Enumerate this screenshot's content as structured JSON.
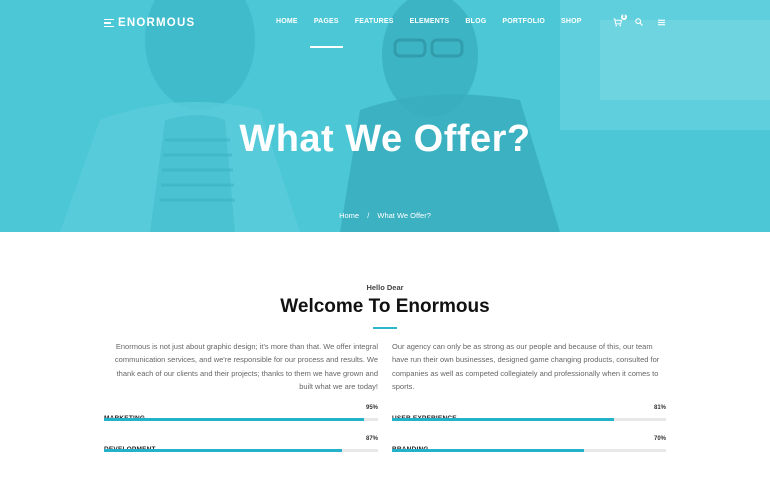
{
  "brand": {
    "name": "ENORMOUS",
    "accent_color": "#23b2c7"
  },
  "nav": {
    "items": [
      {
        "label": "HOME"
      },
      {
        "label": "PAGES",
        "active": true
      },
      {
        "label": "FEATURES"
      },
      {
        "label": "ELEMENTS"
      },
      {
        "label": "BLOG"
      },
      {
        "label": "PORTFOLIO"
      },
      {
        "label": "SHOP"
      }
    ],
    "cart_count": "0",
    "icons": [
      "cart-icon",
      "search-icon",
      "menu-icon"
    ]
  },
  "hero": {
    "title": "What We Offer?",
    "breadcrumb": {
      "home": "Home",
      "separator": "/",
      "current": "What We Offer?"
    }
  },
  "intro": {
    "subtitle": "Hello Dear",
    "title": "Welcome To Enormous",
    "left_text": "Enormous is not just about graphic design; it's more than that. We offer integral communication services, and we're responsible for our process and results. We thank each of our clients and their projects; thanks to them we have grown and built what we are today!",
    "right_text": "Our agency can only be as strong as our people and because of this, our team have run their own businesses, designed game changing products, consulted for companies as well as competed collegiately and professionally when it comes to sports."
  },
  "skills": [
    {
      "label": "MARKETING",
      "percent_text": "95%",
      "value": 95
    },
    {
      "label": "USER EXPERIENCE",
      "percent_text": "81%",
      "value": 81
    },
    {
      "label": "DEVELOPMENT",
      "percent_text": "87%",
      "value": 87
    },
    {
      "label": "BRANDING",
      "percent_text": "70%",
      "value": 70
    }
  ]
}
